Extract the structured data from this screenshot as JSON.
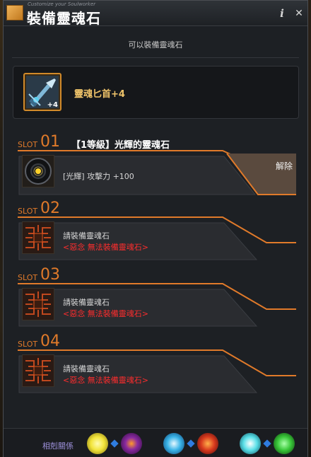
{
  "window": {
    "subtitle": "Customize your Soulworker",
    "title": "裝備靈魂石",
    "info_label": "i",
    "close_label": "✕"
  },
  "header": {
    "text": "可以裝備靈魂石"
  },
  "item": {
    "name": "靈魂匕首+4",
    "badge": "+4",
    "icon": "dagger-icon"
  },
  "slots": [
    {
      "word": "SLOT",
      "number": "01",
      "title": "【1等級】光輝的靈魂石",
      "stone_name": "[光輝] 攻擊力 +100",
      "icon": "glowing-soulstone-icon",
      "action_label": "解除"
    },
    {
      "word": "SLOT",
      "number": "02",
      "line1": "請裝備靈魂石",
      "line2": "<惡念 無法裝備靈魂石>",
      "icon": "empty-circuit-icon"
    },
    {
      "word": "SLOT",
      "number": "03",
      "line1": "請裝備靈魂石",
      "line2": "<惡念 無法裝備靈魂石>",
      "icon": "empty-circuit-icon"
    },
    {
      "word": "SLOT",
      "number": "04",
      "line1": "請裝備靈魂石",
      "line2": "<惡念 無法裝備靈魂石>",
      "icon": "empty-circuit-icon"
    }
  ],
  "footer": {
    "label": "相剋關係",
    "orbs": [
      {
        "icon": "light-orb-icon",
        "color": "#f2e43a"
      },
      {
        "icon": "dark-eye-orb-icon",
        "color": "#8a2aa0"
      },
      {
        "icon": "water-orb-icon",
        "color": "#3ab4e8"
      },
      {
        "icon": "fire-orb-icon",
        "color": "#d83a1e"
      },
      {
        "icon": "ice-orb-icon",
        "color": "#5ae0e8"
      },
      {
        "icon": "poison-orb-icon",
        "color": "#3ac83a"
      }
    ]
  },
  "colors": {
    "accent_orange": "#e07a2a",
    "item_name_gold": "#f0c46a",
    "warning_red": "#ff2d2d"
  }
}
